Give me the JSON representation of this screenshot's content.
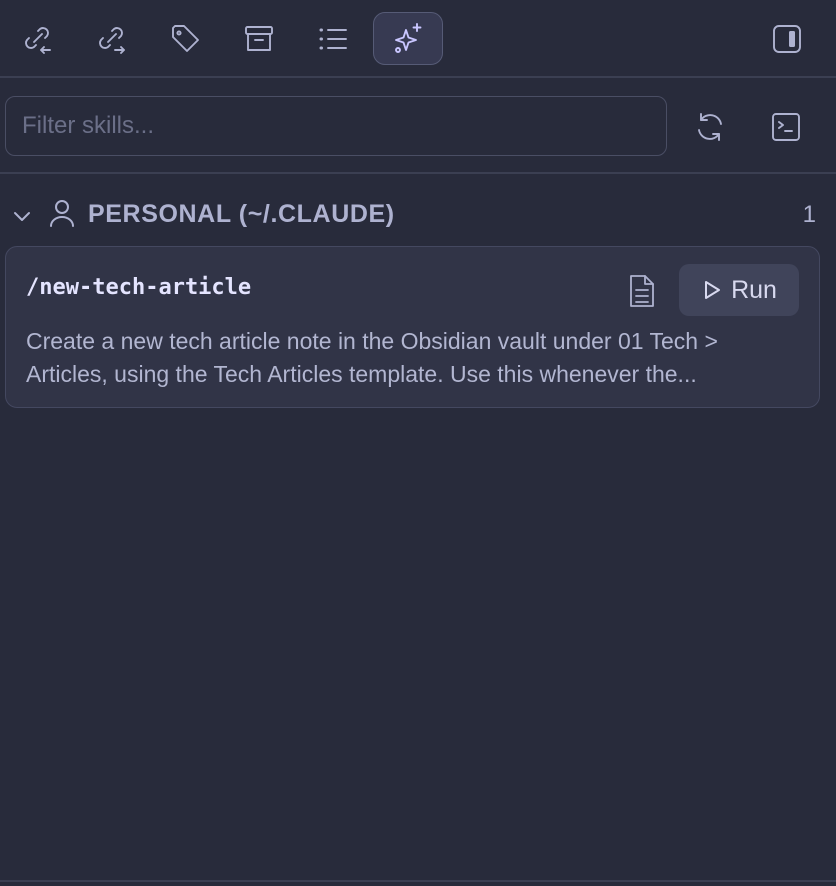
{
  "toolbar": {
    "buttons": [
      {
        "icon": "backlinks-icon",
        "active": false
      },
      {
        "icon": "outgoing-links-icon",
        "active": false
      },
      {
        "icon": "tag-icon",
        "active": false
      },
      {
        "icon": "archive-icon",
        "active": false
      },
      {
        "icon": "list-icon",
        "active": false
      },
      {
        "icon": "sparkles-icon",
        "active": true
      }
    ],
    "right_icon": "sidebar-toggle-icon"
  },
  "filter": {
    "placeholder": "Filter skills...",
    "value": ""
  },
  "section": {
    "title": "PERSONAL (~/.CLAUDE)",
    "count": "1",
    "expanded": true
  },
  "skills": [
    {
      "name": "/new-tech-article",
      "run_label": "Run",
      "description": "Create a new tech article note in the Obsidian vault under 01 Tech >\nArticles, using the Tech Articles template. Use this whenever the..."
    }
  ],
  "colors": {
    "background": "#282b3b",
    "card": "#313447",
    "accent": "#c9c6ff"
  }
}
